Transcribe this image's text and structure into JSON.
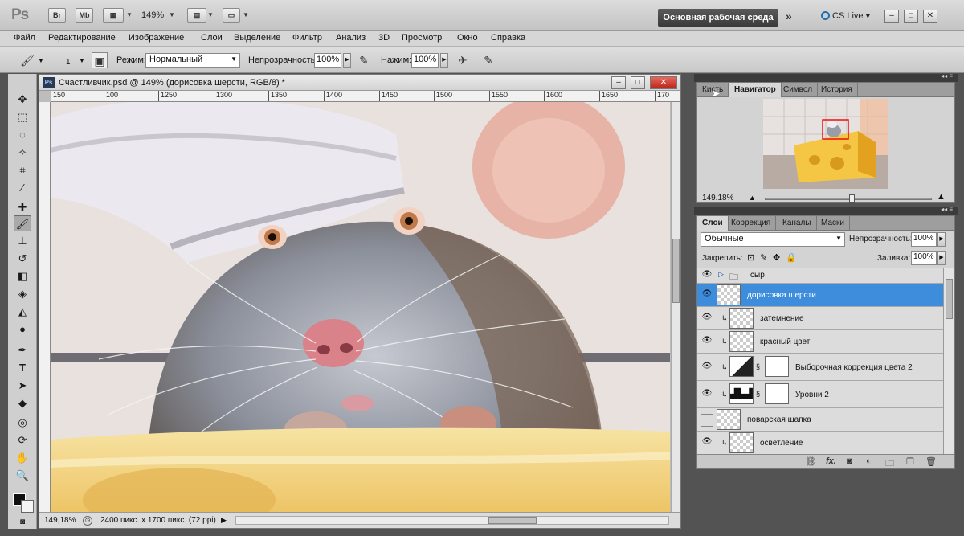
{
  "app": {
    "logo": "Ps",
    "bridge": "Br",
    "minibridge": "Mb",
    "zoom": "149%",
    "workspace": "Основная рабочая среда",
    "more": "»",
    "cslive": "CS Live"
  },
  "menu": [
    "Файл",
    "Редактирование",
    "Изображение",
    "Слои",
    "Выделение",
    "Фильтр",
    "Анализ",
    "3D",
    "Просмотр",
    "Окно",
    "Справка"
  ],
  "options": {
    "brush_size": "1",
    "mode_label": "Режим:",
    "mode_value": "Нормальный",
    "opacity_label": "Непрозрачность:",
    "opacity_value": "100%",
    "flow_label": "Нажим:",
    "flow_value": "100%"
  },
  "document": {
    "title": "Счастливчик.psd @ 149% (дорисовка шерсти, RGB/8) *",
    "ruler_ticks": [
      "150",
      "100",
      "1250",
      "1300",
      "1350",
      "1400",
      "1450",
      "1500",
      "1550",
      "1600",
      "1650",
      "170"
    ],
    "status_zoom": "149,18%",
    "status_info": "2400 пикс. x 1700 пикс. (72 ppi)"
  },
  "navigator": {
    "tabs": [
      "Кисть",
      "Навигатор",
      "Символ",
      "История"
    ],
    "active_tab": "Навигатор",
    "zoom": "149.18%"
  },
  "layers": {
    "tabs": [
      "Слои",
      "Коррекция",
      "Каналы",
      "Маски"
    ],
    "active_tab": "Слои",
    "blend_mode": "Обычные",
    "opacity_label": "Непрозрачность:",
    "opacity_value": "100%",
    "lock_label": "Закрепить:",
    "fill_label": "Заливка:",
    "fill_value": "100%",
    "items": [
      {
        "name": "сыр",
        "kind": "group"
      },
      {
        "name": "дорисовка шерсти",
        "kind": "pixel",
        "selected": true
      },
      {
        "name": "затемнение",
        "kind": "pixel",
        "clipped": true
      },
      {
        "name": "красный цвет",
        "kind": "pixel",
        "clipped": true
      },
      {
        "name": "Выборочная коррекция цвета 2",
        "kind": "adjustment",
        "clipped": true
      },
      {
        "name": "Уровни 2",
        "kind": "adjustment",
        "clipped": true
      },
      {
        "name": "поварская шапка",
        "kind": "pixel",
        "hidden": true
      },
      {
        "name": "осветление",
        "kind": "pixel",
        "clipped": true
      }
    ]
  },
  "colors": {
    "accent": "#3e8ddd",
    "workspace_button": "#3a3a3a",
    "cheese": "#f2cf6e"
  }
}
